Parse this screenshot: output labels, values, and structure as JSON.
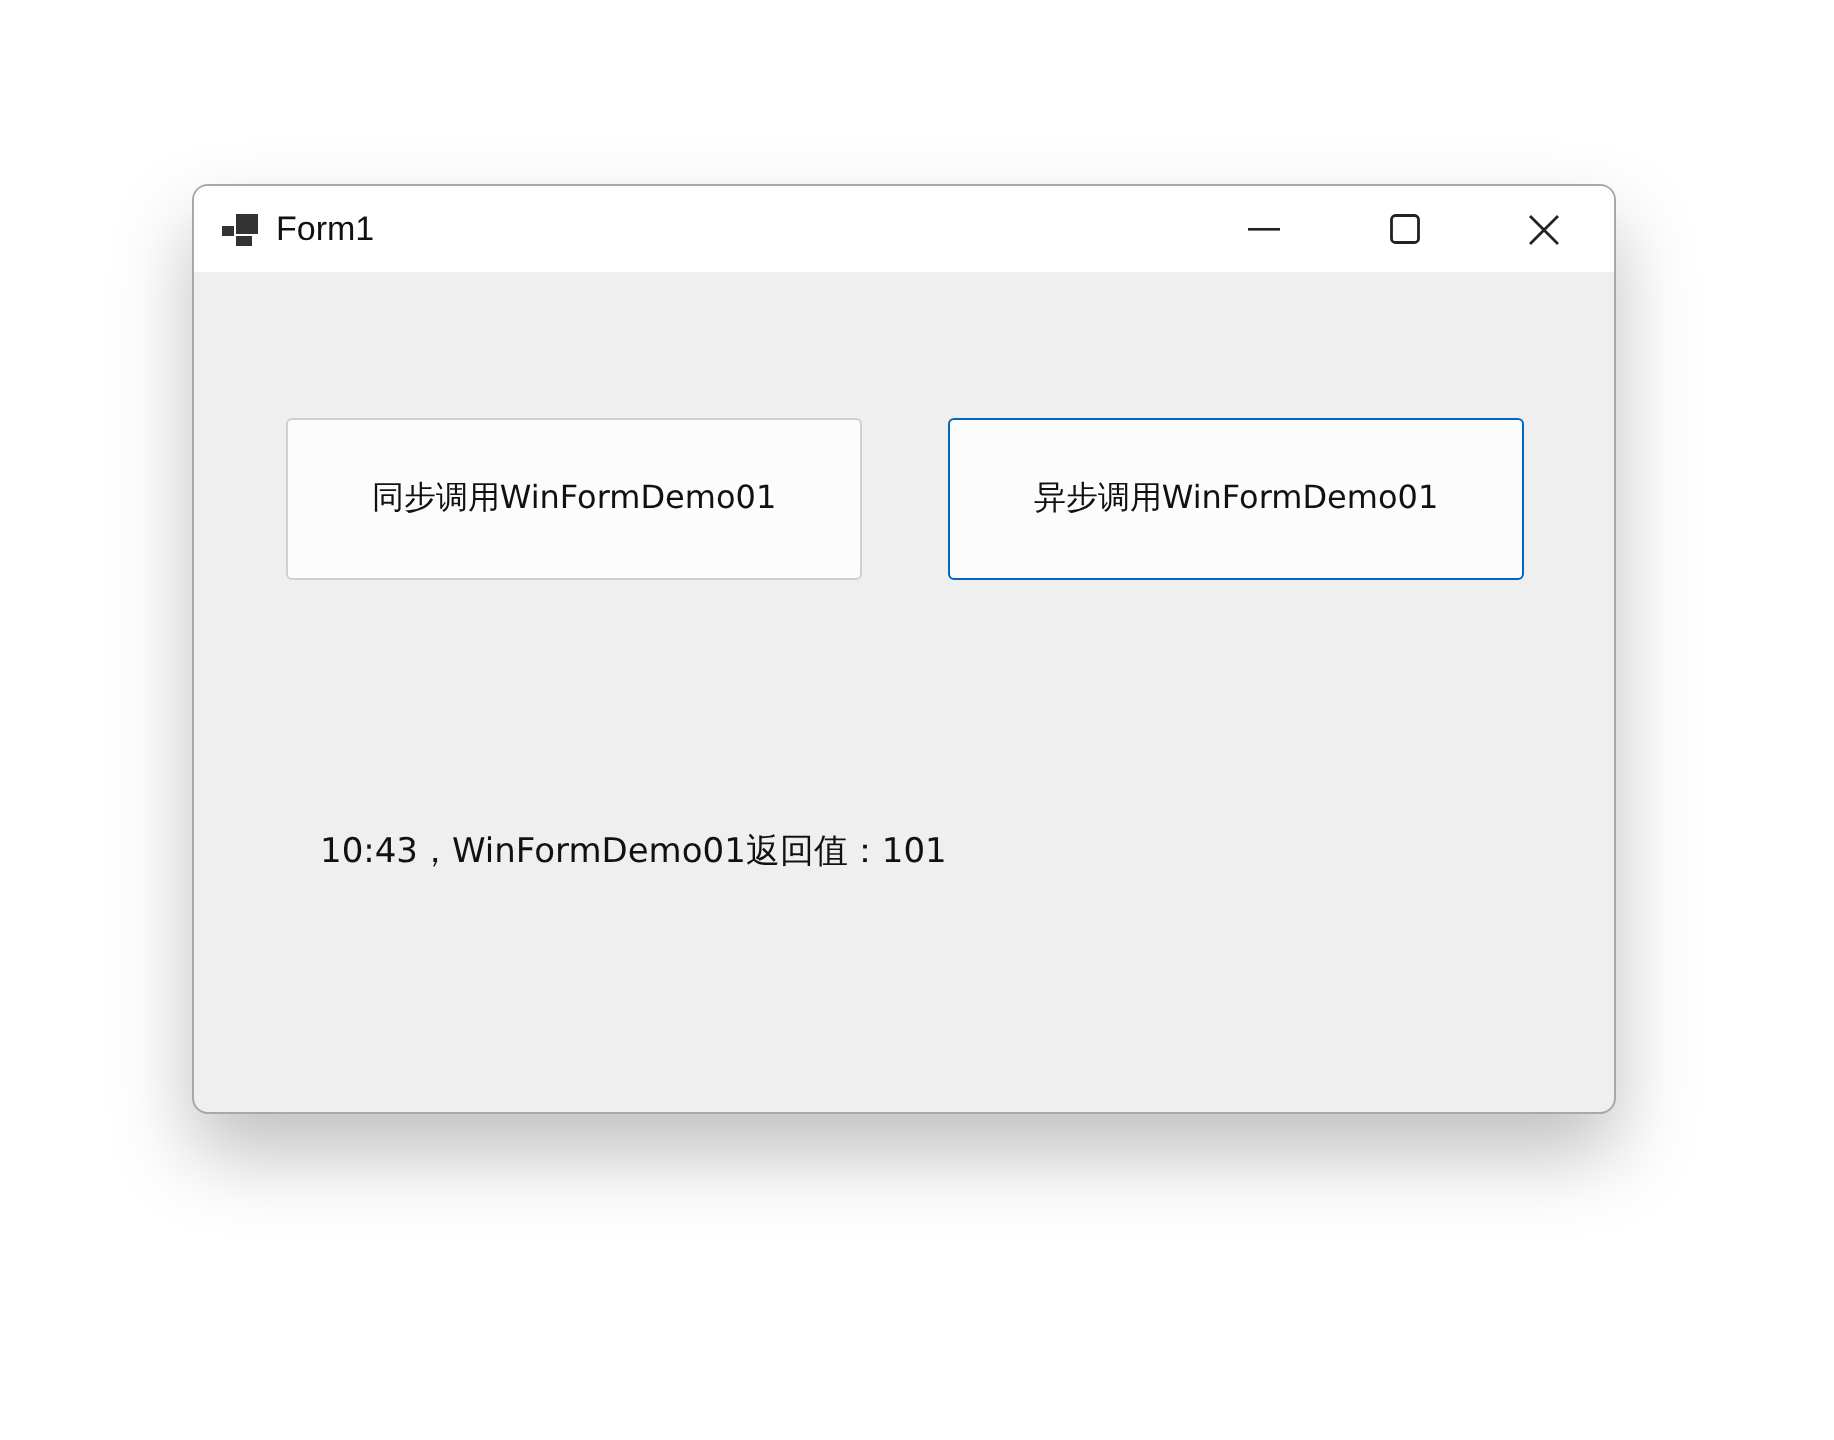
{
  "window": {
    "title": "Form1"
  },
  "buttons": [
    {
      "label": "同步调用WinFormDemo01",
      "focused": false
    },
    {
      "label": "异步调用WinFormDemo01",
      "focused": true
    }
  ],
  "result_label": "10:43，WinFormDemo01返回值：101"
}
